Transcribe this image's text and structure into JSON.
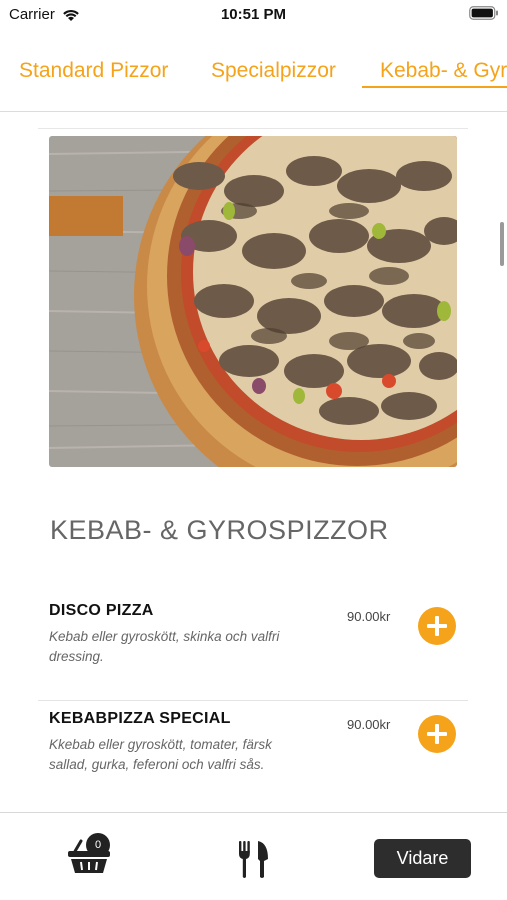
{
  "status_bar": {
    "carrier": "Carrier",
    "time": "10:51 PM"
  },
  "tabs": [
    {
      "label": "Standard Pizzor"
    },
    {
      "label": "Specialpizzor"
    },
    {
      "label": "Kebab- & Gyrospizzor",
      "selected": true
    }
  ],
  "section": {
    "title": "KEBAB- & GYROSPIZZOR"
  },
  "items": [
    {
      "name": "DISCO PIZZA",
      "description": "Kebab eller gyroskött, skinka och valfri dressing.",
      "price": "90.00kr"
    },
    {
      "name": "KEBABPIZZA SPECIAL",
      "description": "Kkebab eller gyroskött, tomater, färsk sallad, gurka, feferoni och valfri sås.",
      "price": "90.00kr"
    }
  ],
  "bottom_bar": {
    "cart_count": "0",
    "next_label": "Vidare"
  },
  "colors": {
    "accent": "#f5a31a",
    "button_dark": "#2d2d2d"
  },
  "icons": [
    "wifi-icon",
    "battery-icon",
    "plus-icon",
    "basket-icon",
    "cutlery-icon"
  ]
}
